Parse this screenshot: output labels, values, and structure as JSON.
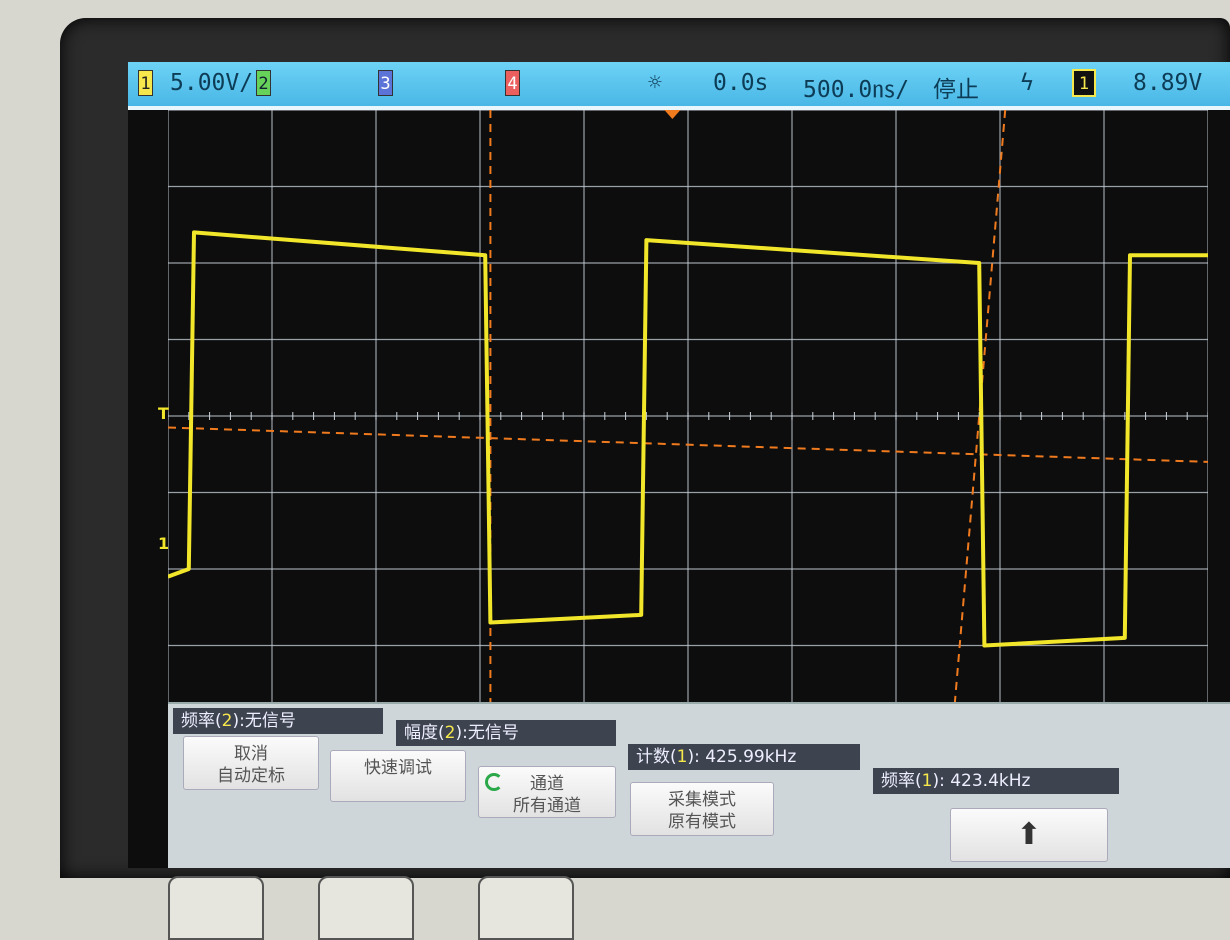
{
  "status_bar": {
    "ch1_num": "1",
    "ch1_scale": "5.00V/",
    "ch2_num": "2",
    "ch3_num": "3",
    "ch4_num": "4",
    "acq_icon": "sun-icon",
    "delay": "0.0s",
    "timebase": "500.0㎱/",
    "run_state": "停止",
    "trigger_icon": "rising-edge-icon",
    "trigger_source": "1",
    "trigger_level": "8.89V"
  },
  "markers": {
    "trigger_level_marker": "T",
    "ch1_ground_marker": "1"
  },
  "measurements": [
    {
      "label_pre": "频率(",
      "ch": "2",
      "label_post": "):无信号"
    },
    {
      "label_pre": "幅度(",
      "ch": "2",
      "label_post": "):无信号"
    },
    {
      "label_pre": "计数(",
      "ch": "1",
      "label_post": "): 425.99kHz"
    },
    {
      "label_pre": "频率(",
      "ch": "1",
      "label_post": "): 423.4kHz"
    }
  ],
  "softkeys": [
    {
      "line1": "取消",
      "line2": "自动定标"
    },
    {
      "line1": "快速调试",
      "line2": ""
    },
    {
      "line1": "通道",
      "line2": "所有通道"
    },
    {
      "line1": "采集模式",
      "line2": "原有模式"
    },
    {
      "line1": "⬆",
      "line2": ""
    }
  ],
  "colors": {
    "trace": "#f2e62a",
    "grid": "#c9d2dc",
    "cursor": "#f07a1e",
    "status_bg": "#55bce9"
  },
  "chart_data": {
    "type": "line",
    "series": [
      {
        "x_div": [
          0,
          0.2,
          0.25,
          3.05,
          3.1,
          4.55,
          4.6,
          7.8,
          7.85,
          9.2,
          9.25,
          10
        ],
        "y_div": [
          -2.1,
          -2.0,
          2.4,
          2.1,
          -2.7,
          -2.6,
          2.3,
          2.0,
          -3.0,
          -2.9,
          2.1,
          2.1
        ]
      }
    ],
    "divisions_x": 10,
    "divisions_y": 8
  }
}
